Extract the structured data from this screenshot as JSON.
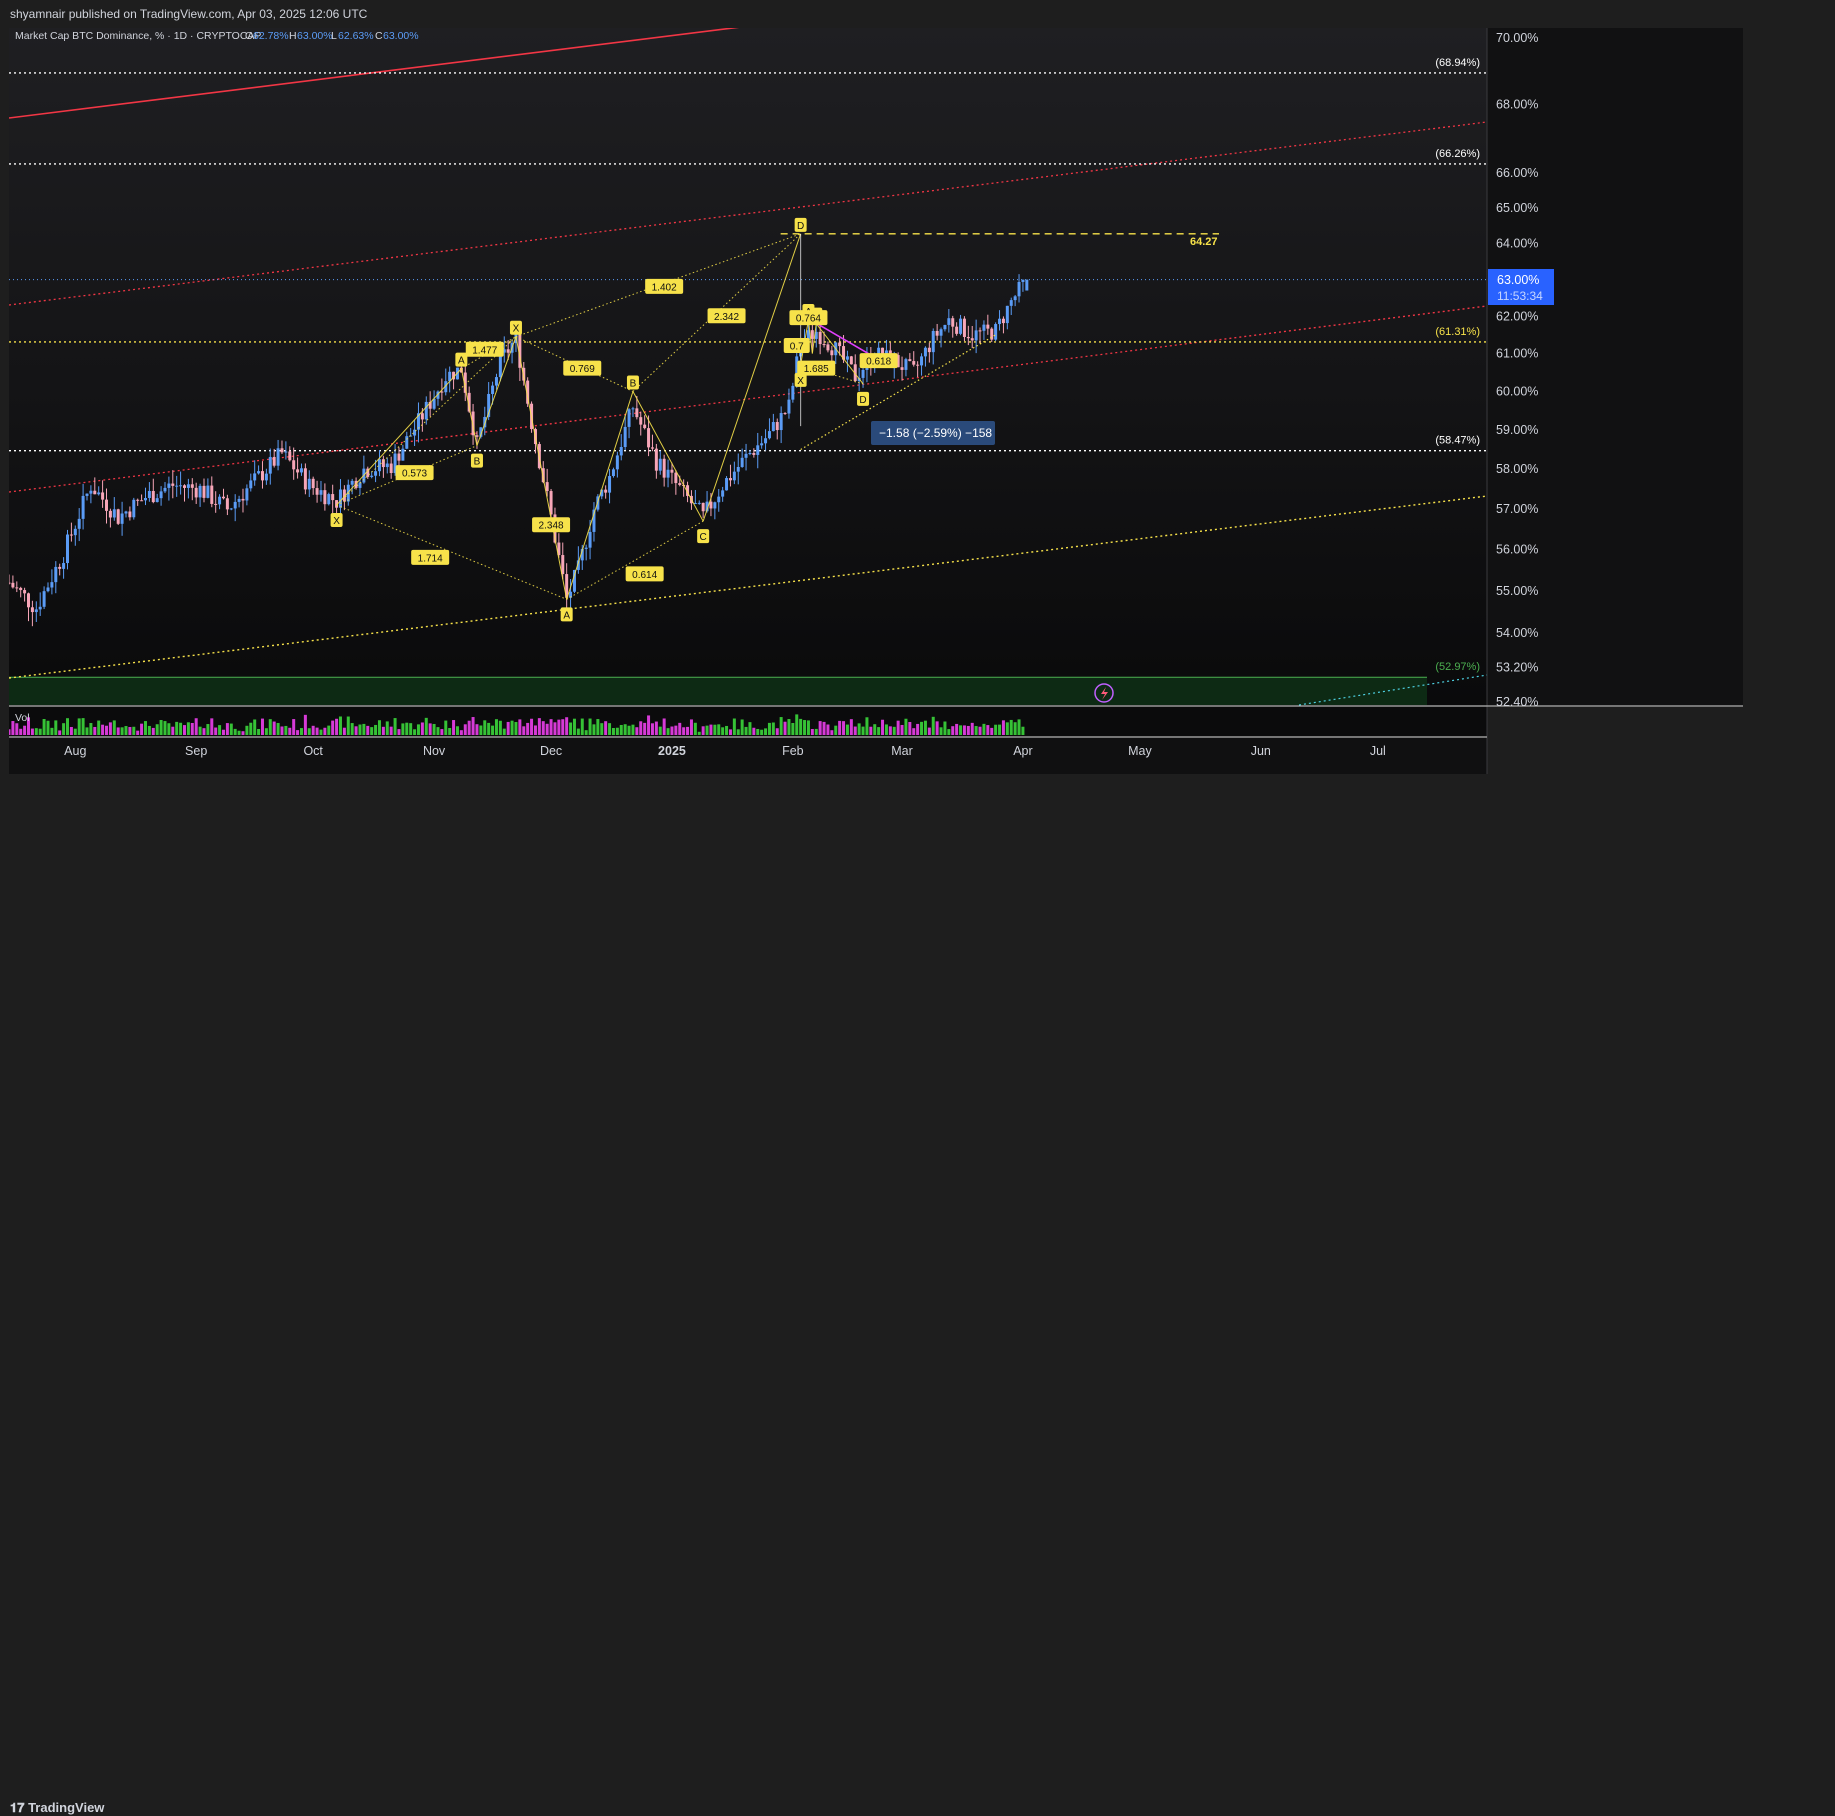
{
  "publish_line": "shyamnair published on TradingView.com, Apr 03, 2025 12:06 UTC",
  "footer_brand": "TradingView",
  "legend": {
    "symbol": "Market Cap BTC Dominance, % · 1D · CRYPTOCAP",
    "o_label": "O",
    "o_value": "62.78%",
    "h_label": "H",
    "h_value": "63.00%",
    "l_label": "L",
    "l_value": "62.63%",
    "c_label": "C",
    "c_value": "63.00%"
  },
  "volume_label": "Vol",
  "price_tag": {
    "price": "63.00%",
    "countdown": "11:53:34"
  },
  "measure_label": "−1.58 (−2.59%) −158",
  "target_label": "64.27",
  "colors": {
    "up": "#5b9cf6",
    "down": "#f7a6b8",
    "level_line": "#ffffff",
    "fib_yellow": "#f7e24a",
    "red_channel": "#f23645",
    "green_line": "#4caf50",
    "tag_blue": "#2962ff"
  },
  "chart_data": {
    "type": "candlestick",
    "title": "Market Cap BTC Dominance, % · 1D · CRYPTOCAP",
    "ylim": [
      52.4,
      70.3
    ],
    "y_scale": "log",
    "y_ticks": [
      "70.00%",
      "68.00%",
      "66.00%",
      "65.00%",
      "64.00%",
      "63.00%",
      "62.00%",
      "61.00%",
      "60.00%",
      "59.00%",
      "58.00%",
      "57.00%",
      "56.00%",
      "55.00%",
      "54.00%",
      "53.20%",
      "52.40%"
    ],
    "y_tick_values": [
      70,
      68,
      66,
      65,
      64,
      63,
      62,
      61,
      60,
      59,
      58,
      57,
      56,
      55,
      54,
      53.2,
      52.4
    ],
    "x_ticks": [
      "Aug",
      "Sep",
      "Oct",
      "Nov",
      "Dec",
      "2025",
      "Feb",
      "Mar",
      "Apr",
      "May",
      "Jun",
      "Jul"
    ],
    "x_range": [
      "2024-07-15",
      "2025-07-29"
    ],
    "last_close": 63.0,
    "close_path": [
      {
        "date": "2024-07-15",
        "value": 55.2
      },
      {
        "date": "2024-07-22",
        "value": 54.6
      },
      {
        "date": "2024-07-29",
        "value": 55.9
      },
      {
        "date": "2024-08-05",
        "value": 57.6
      },
      {
        "date": "2024-08-12",
        "value": 56.8
      },
      {
        "date": "2024-08-19",
        "value": 57.3
      },
      {
        "date": "2024-08-26",
        "value": 57.6
      },
      {
        "date": "2024-09-02",
        "value": 57.5
      },
      {
        "date": "2024-09-09",
        "value": 57.0
      },
      {
        "date": "2024-09-16",
        "value": 57.7
      },
      {
        "date": "2024-09-23",
        "value": 58.4
      },
      {
        "date": "2024-09-30",
        "value": 57.6
      },
      {
        "date": "2024-10-07",
        "value": 57.2
      },
      {
        "date": "2024-10-14",
        "value": 58.0
      },
      {
        "date": "2024-10-21",
        "value": 58.1
      },
      {
        "date": "2024-10-28",
        "value": 59.2
      },
      {
        "date": "2024-11-04",
        "value": 60.4
      },
      {
        "date": "2024-11-08",
        "value": 60.6
      },
      {
        "date": "2024-11-12",
        "value": 58.6
      },
      {
        "date": "2024-11-18",
        "value": 60.8
      },
      {
        "date": "2024-11-22",
        "value": 61.4
      },
      {
        "date": "2024-11-26",
        "value": 59.2
      },
      {
        "date": "2024-12-01",
        "value": 56.8
      },
      {
        "date": "2024-12-05",
        "value": 54.8
      },
      {
        "date": "2024-12-08",
        "value": 55.5
      },
      {
        "date": "2024-12-12",
        "value": 57.0
      },
      {
        "date": "2024-12-16",
        "value": 57.8
      },
      {
        "date": "2024-12-22",
        "value": 59.6
      },
      {
        "date": "2024-12-28",
        "value": 58.2
      },
      {
        "date": "2025-01-03",
        "value": 57.5
      },
      {
        "date": "2025-01-09",
        "value": 56.8
      },
      {
        "date": "2025-01-14",
        "value": 57.6
      },
      {
        "date": "2025-01-20",
        "value": 58.3
      },
      {
        "date": "2025-01-26",
        "value": 58.9
      },
      {
        "date": "2025-01-31",
        "value": 59.6
      },
      {
        "date": "2025-02-03",
        "value": 61.3
      },
      {
        "date": "2025-02-07",
        "value": 61.6
      },
      {
        "date": "2025-02-12",
        "value": 61.1
      },
      {
        "date": "2025-02-17",
        "value": 60.4
      },
      {
        "date": "2025-02-22",
        "value": 61.0
      },
      {
        "date": "2025-02-27",
        "value": 60.8
      },
      {
        "date": "2025-03-04",
        "value": 60.5
      },
      {
        "date": "2025-03-09",
        "value": 61.4
      },
      {
        "date": "2025-03-13",
        "value": 61.9
      },
      {
        "date": "2025-03-19",
        "value": 61.5
      },
      {
        "date": "2025-03-25",
        "value": 61.6
      },
      {
        "date": "2025-03-29",
        "value": 62.4
      },
      {
        "date": "2025-04-02",
        "value": 63.0
      }
    ],
    "horizontal_levels": [
      {
        "label": "(68.94%)",
        "value": 68.94
      },
      {
        "label": "(66.26%)",
        "value": 66.26
      },
      {
        "label": "(61.31%)",
        "value": 61.31
      },
      {
        "label": "(58.47%)",
        "value": 58.47
      },
      {
        "label": "(52.97%)",
        "value": 52.97
      }
    ],
    "target_level": 64.27,
    "harmonic_points": [
      {
        "label": "X",
        "date": "2024-10-07",
        "value": 57.1
      },
      {
        "label": "A",
        "date": "2024-11-08",
        "value": 60.6
      },
      {
        "label": "B",
        "date": "2024-11-12",
        "value": 58.6
      },
      {
        "label": "X",
        "date": "2024-11-22",
        "value": 61.45
      },
      {
        "label": "A",
        "date": "2024-12-05",
        "value": 54.8
      },
      {
        "label": "B",
        "date": "2024-12-22",
        "value": 60.0
      },
      {
        "label": "C",
        "date": "2025-01-09",
        "value": 56.7
      },
      {
        "label": "D",
        "date": "2025-02-03",
        "value": 64.27
      },
      {
        "label": "X",
        "date": "2025-02-03",
        "value": 60.7
      },
      {
        "label": "A",
        "date": "2025-02-05",
        "value": 61.9
      },
      {
        "label": "C",
        "date": "2025-02-07",
        "value": 61.8
      },
      {
        "label": "B",
        "date": "2025-02-06",
        "value": 61.0
      },
      {
        "label": "D",
        "date": "2025-02-19",
        "value": 60.2
      }
    ],
    "ratio_labels": [
      {
        "label": "1.477",
        "date": "2024-11-14",
        "value": 61.1
      },
      {
        "label": "0.573",
        "date": "2024-10-27",
        "value": 57.9
      },
      {
        "label": "1.714",
        "date": "2024-10-31",
        "value": 55.8
      },
      {
        "label": "2.348",
        "date": "2024-12-01",
        "value": 56.6
      },
      {
        "label": "0.769",
        "date": "2024-12-09",
        "value": 60.6
      },
      {
        "label": "1.402",
        "date": "2024-12-30",
        "value": 62.8
      },
      {
        "label": "2.342",
        "date": "2025-01-15",
        "value": 62.0
      },
      {
        "label": "0.614",
        "date": "2024-12-25",
        "value": 55.4
      },
      {
        "label": "0.764",
        "date": "2025-02-05",
        "value": 61.95
      },
      {
        "label": "0.7",
        "date": "2025-02-02",
        "value": 61.2
      },
      {
        "label": "1.685",
        "date": "2025-02-07",
        "value": 60.6
      },
      {
        "label": "0.618",
        "date": "2025-02-23",
        "value": 60.8
      }
    ],
    "volume_series": "relative"
  }
}
